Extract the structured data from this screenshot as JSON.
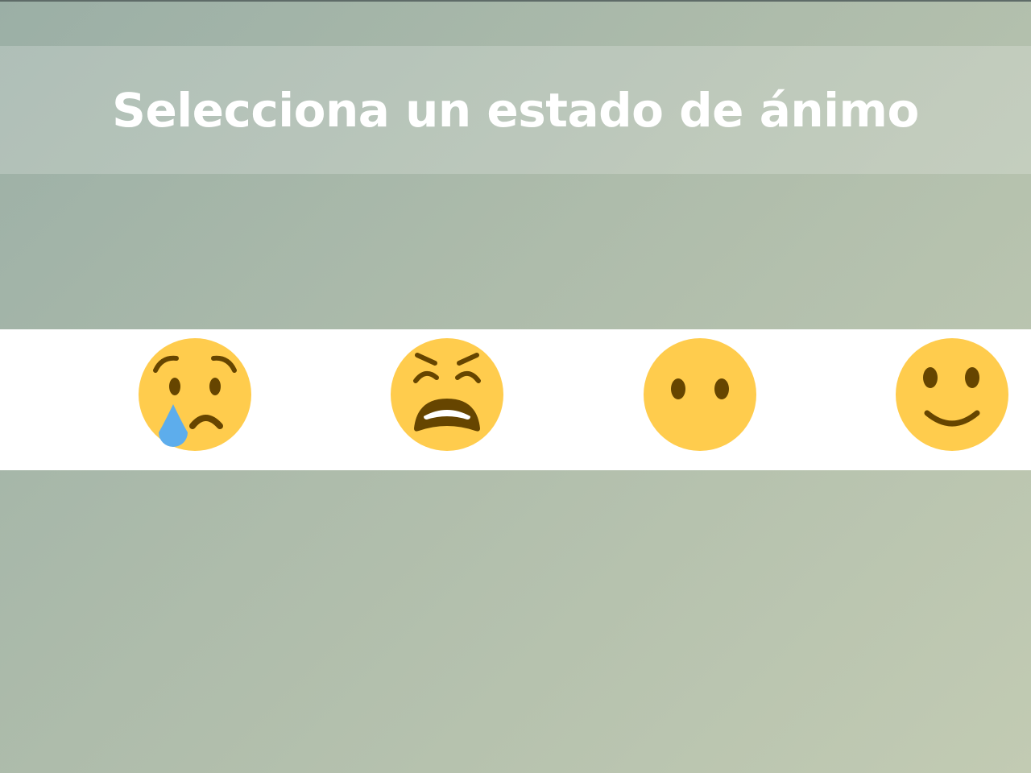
{
  "header": {
    "title": "Selecciona un estado de ánimo"
  },
  "moods": [
    {
      "icon": "crying-face-icon"
    },
    {
      "icon": "weary-face-icon"
    },
    {
      "icon": "face-without-mouth-icon"
    },
    {
      "icon": "slightly-smiling-face-icon"
    }
  ],
  "colors": {
    "background_start": "#9bafa6",
    "background_end": "#c2cbb3",
    "emoji_face": "#FFCC4D",
    "emoji_features": "#664500",
    "tear": "#5DADEC",
    "mood_bar": "#ffffff",
    "title_text": "#ffffff"
  }
}
